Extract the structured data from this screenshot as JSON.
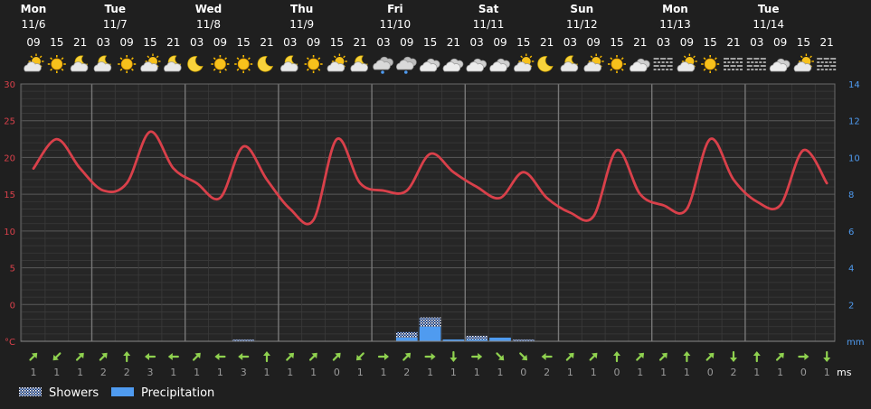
{
  "chart_data": {
    "type": "line",
    "days": [
      {
        "day": "Mon",
        "date": "11/6"
      },
      {
        "day": "Tue",
        "date": "11/7"
      },
      {
        "day": "Wed",
        "date": "11/8"
      },
      {
        "day": "Thu",
        "date": "11/9"
      },
      {
        "day": "Fri",
        "date": "11/10"
      },
      {
        "day": "Sat",
        "date": "11/11"
      },
      {
        "day": "Sun",
        "date": "11/12"
      },
      {
        "day": "Mon",
        "date": "11/13"
      },
      {
        "day": "Tue",
        "date": "11/14"
      }
    ],
    "hours": [
      "09",
      "15",
      "21",
      "03",
      "09",
      "15",
      "21",
      "03",
      "09",
      "15",
      "21",
      "03",
      "09",
      "15",
      "21",
      "03",
      "09",
      "15",
      "21",
      "03",
      "09",
      "15",
      "21",
      "03",
      "09",
      "15",
      "21",
      "03",
      "09",
      "15",
      "21",
      "03",
      "09",
      "15",
      "21"
    ],
    "weather_icons": [
      "sun-cloud",
      "sun",
      "moon-cloud",
      "moon-cloud",
      "sun",
      "sun-cloud",
      "moon-cloud",
      "moon",
      "sun",
      "sun",
      "moon",
      "moon-cloud",
      "sun",
      "sun-cloud",
      "moon-cloud",
      "cloud-rain",
      "cloud-rain",
      "cloud",
      "cloud",
      "cloud",
      "cloud",
      "sun-cloud",
      "moon",
      "moon-cloud",
      "sun-cloud",
      "sun",
      "cloud",
      "fog",
      "sun-cloud",
      "sun",
      "fog",
      "fog",
      "cloud",
      "sun-cloud",
      "fog"
    ],
    "temperature": {
      "name": "Temperature",
      "unit": "°C",
      "color": "#d9404a",
      "values": [
        18.5,
        22.5,
        18.5,
        15.5,
        16.5,
        23.5,
        18.5,
        16.5,
        14.5,
        21.5,
        17,
        13,
        11.5,
        22.5,
        16.5,
        15.5,
        15.5,
        20.5,
        18,
        16,
        14.5,
        18,
        14.5,
        12.5,
        12.0,
        21.0,
        15.0,
        13.5,
        13.0,
        22.5,
        17.0,
        14.0,
        13.5,
        21.0,
        16.5
      ]
    },
    "showers": {
      "name": "Showers",
      "unit": "mm",
      "values": [
        0,
        0,
        0,
        0,
        0,
        0,
        0,
        0,
        0,
        0.1,
        0,
        0,
        0,
        0,
        0,
        0,
        0.5,
        1.3,
        0.1,
        0.3,
        0.2,
        0.1,
        0,
        0,
        0,
        0,
        0,
        0,
        0,
        0,
        0,
        0,
        0,
        0,
        0
      ]
    },
    "precipitation": {
      "name": "Precipitation",
      "unit": "mm",
      "color": "#4f9bf0",
      "values": [
        0,
        0,
        0,
        0,
        0,
        0,
        0,
        0,
        0,
        0,
        0,
        0,
        0,
        0,
        0,
        0,
        0.2,
        0.8,
        0.1,
        0.1,
        0.2,
        0.0,
        0,
        0,
        0,
        0,
        0,
        0,
        0,
        0,
        0,
        0,
        0,
        0,
        0
      ]
    },
    "wind_speed": {
      "unit": "ms",
      "values": [
        1,
        1,
        1,
        2,
        2,
        3,
        1,
        1,
        1,
        3,
        1,
        1,
        1,
        0,
        1,
        1,
        2,
        1,
        1,
        1,
        1,
        0,
        2,
        1,
        1,
        0,
        1,
        1,
        1,
        0,
        2,
        1,
        1,
        0,
        1
      ]
    },
    "wind_direction_deg": [
      45,
      225,
      45,
      45,
      0,
      270,
      270,
      45,
      270,
      270,
      0,
      45,
      45,
      45,
      225,
      90,
      45,
      90,
      180,
      90,
      135,
      135,
      270,
      45,
      45,
      0,
      45,
      45,
      0,
      45,
      180,
      0,
      45,
      90,
      180
    ],
    "y_left": {
      "unit": "°C",
      "ticks": [
        30,
        25,
        20,
        15,
        10,
        5,
        0
      ],
      "range": [
        -5,
        30
      ]
    },
    "y_right": {
      "unit": "mm",
      "ticks": [
        14,
        12,
        10,
        8,
        6,
        4,
        2
      ],
      "range": [
        0,
        14
      ]
    },
    "legend": {
      "showers": "Showers",
      "precipitation": "Precipitation"
    },
    "colors": {
      "background": "#1f1f1f",
      "plot_bg": "#262626",
      "grid": "#4a4a4a",
      "day_line": "#777777",
      "left_axis": "#d9404a",
      "right_axis": "#4f9bf0",
      "wind_arrow": "#8fd14f",
      "wind_text": "#9a9a9a"
    }
  }
}
